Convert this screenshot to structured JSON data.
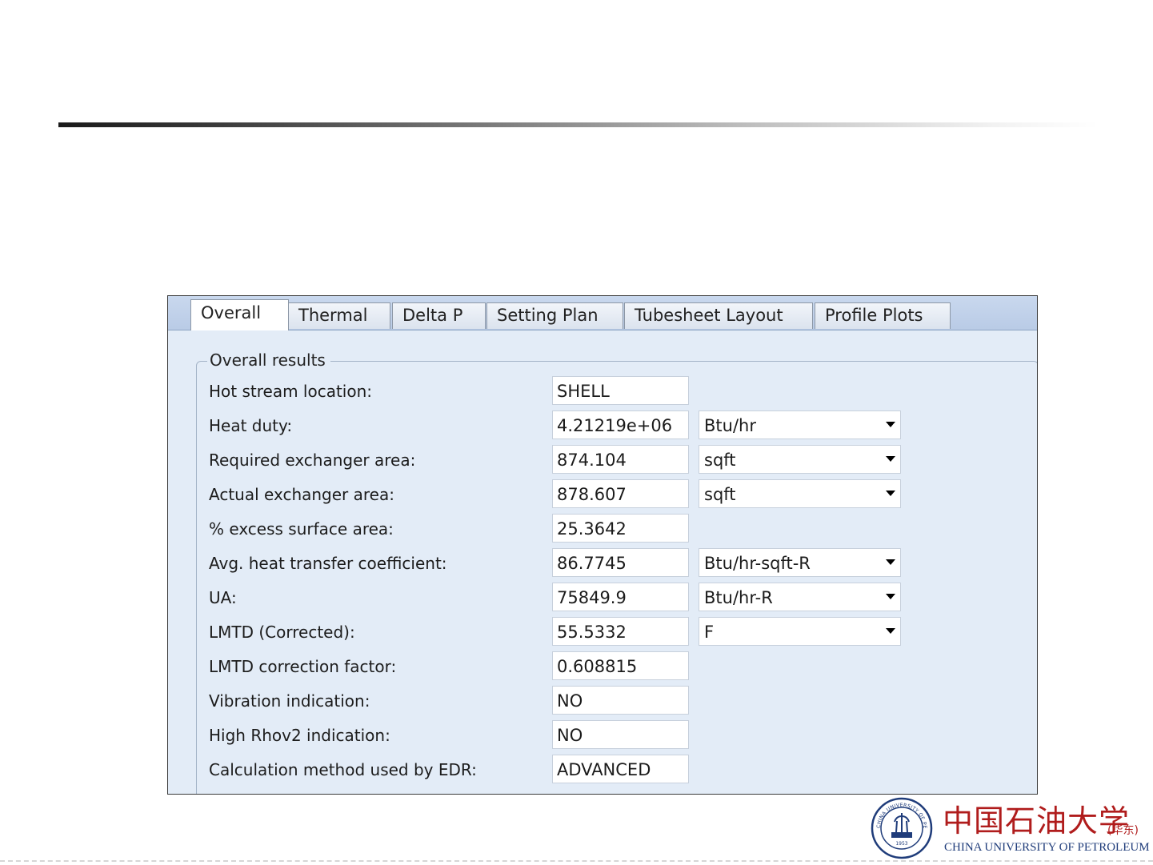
{
  "tabs": [
    {
      "label": "Overall",
      "active": true
    },
    {
      "label": "Thermal",
      "active": false
    },
    {
      "label": "Delta P",
      "active": false
    },
    {
      "label": "Setting Plan",
      "active": false
    },
    {
      "label": "Tubesheet Layout",
      "active": false
    },
    {
      "label": "Profile Plots",
      "active": false
    }
  ],
  "group_title": "Overall results",
  "rows": [
    {
      "label": "Hot stream location:",
      "value": "SHELL"
    },
    {
      "label": "Heat duty:",
      "value": "4.21219e+06",
      "unit": "Btu/hr"
    },
    {
      "label": "Required exchanger area:",
      "value": "874.104",
      "unit": "sqft"
    },
    {
      "label": "Actual exchanger area:",
      "value": "878.607",
      "unit": "sqft"
    },
    {
      "label": "% excess surface area:",
      "value": "25.3642"
    },
    {
      "label": "Avg. heat transfer coefficient:",
      "value": "86.7745",
      "unit": "Btu/hr-sqft-R"
    },
    {
      "label": "UA:",
      "value": "75849.9",
      "unit": "Btu/hr-R"
    },
    {
      "label": "LMTD (Corrected):",
      "value": "55.5332",
      "unit": "F"
    },
    {
      "label": "LMTD correction factor:",
      "value": "0.608815"
    },
    {
      "label": "Vibration indication:",
      "value": "NO"
    },
    {
      "label": "High Rhov2 indication:",
      "value": "NO"
    },
    {
      "label": "Calculation method used by EDR:",
      "value": "ADVANCED"
    }
  ],
  "branding": {
    "name_cn": "中国石油大学",
    "campus_cn": "(华东)",
    "name_en": "CHINA UNIVERSITY OF PETROLEUM",
    "seal_text": "CHINA UNIVERSITY OF PETROLEUM",
    "seal_year": "1953",
    "color": "#b01c1c",
    "seal_color": "#1f3c7a"
  }
}
